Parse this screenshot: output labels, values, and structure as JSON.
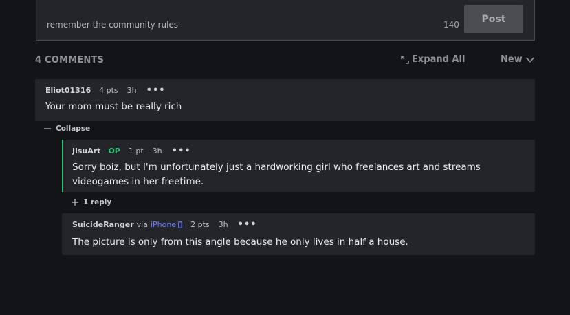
{
  "composer": {
    "hint": "remember the community rules",
    "char_count": "140",
    "post_label": "Post"
  },
  "header": {
    "comments_count": "4 COMMENTS",
    "expand_all": "Expand All",
    "sort_label": "New"
  },
  "comments": [
    {
      "author": "Eliot01316",
      "points": "4 pts",
      "time": "3h",
      "more": "•••",
      "body": "Your mom must be really rich"
    },
    {
      "author": "JisuArt",
      "badge": "OP",
      "points": "1 pt",
      "time": "3h",
      "more": "•••",
      "body": "Sorry boiz, but I'm unfortunately just a hardworking girl who freelances art and streams videogames in her freetime.",
      "replies": "1 reply"
    },
    {
      "author": "SuicideRanger",
      "via": "via",
      "device": "iPhone",
      "points": "2 pts",
      "time": "3h",
      "more": "•••",
      "body": "The picture is only from this angle because he only lives in half a house."
    }
  ],
  "collapse_label": "Collapse",
  "colors": {
    "op": "#2ec26f",
    "device": "#6f7fff"
  }
}
